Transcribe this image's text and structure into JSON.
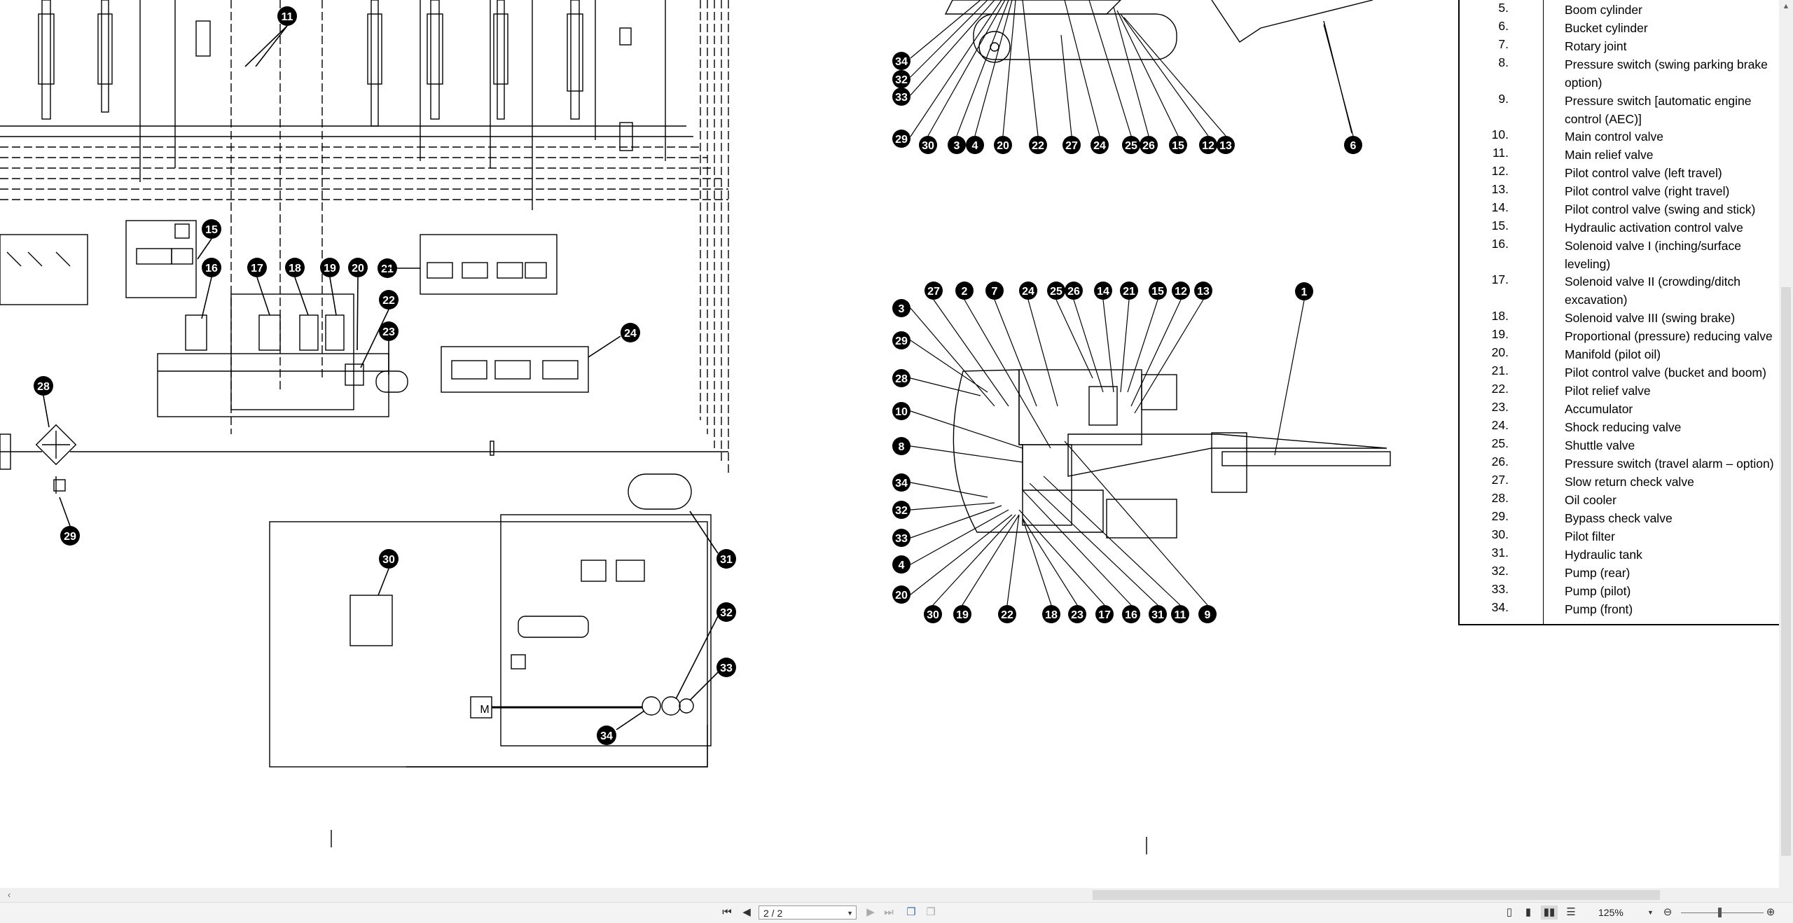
{
  "window": {
    "title": ""
  },
  "document": {
    "legend_items": [
      {
        "num": "5.",
        "text": "Boom cylinder"
      },
      {
        "num": "6.",
        "text": "Bucket cylinder"
      },
      {
        "num": "7.",
        "text": "Rotary joint"
      },
      {
        "num": "8.",
        "text": "Pressure switch (swing parking brake option)"
      },
      {
        "num": "9.",
        "text": "Pressure switch [automatic engine control (AEC)]"
      },
      {
        "num": "10.",
        "text": "Main control valve"
      },
      {
        "num": "11.",
        "text": "Main relief valve"
      },
      {
        "num": "12.",
        "text": "Pilot control valve (left travel)"
      },
      {
        "num": "13.",
        "text": "Pilot control valve (right travel)"
      },
      {
        "num": "14.",
        "text": "Pilot control valve (swing and stick)"
      },
      {
        "num": "15.",
        "text": "Hydraulic activation control valve"
      },
      {
        "num": "16.",
        "text": "Solenoid valve I (inching/surface leveling)"
      },
      {
        "num": "17.",
        "text": "Solenoid valve II (crowding/ditch excavation)"
      },
      {
        "num": "18.",
        "text": "Solenoid valve III (swing brake)"
      },
      {
        "num": "19.",
        "text": "Proportional (pressure) reducing valve"
      },
      {
        "num": "20.",
        "text": "Manifold (pilot oil)"
      },
      {
        "num": "21.",
        "text": "Pilot control valve (bucket and boom)"
      },
      {
        "num": "22.",
        "text": "Pilot relief valve"
      },
      {
        "num": "23.",
        "text": "Accumulator"
      },
      {
        "num": "24.",
        "text": "Shock reducing valve"
      },
      {
        "num": "25.",
        "text": "Shuttle valve"
      },
      {
        "num": "26.",
        "text": "Pressure switch (travel alarm – option)"
      },
      {
        "num": "27.",
        "text": "Slow return check valve"
      },
      {
        "num": "28.",
        "text": "Oil cooler"
      },
      {
        "num": "29.",
        "text": "Bypass check valve"
      },
      {
        "num": "30.",
        "text": "Pilot filter"
      },
      {
        "num": "31.",
        "text": "Hydraulic tank"
      },
      {
        "num": "32.",
        "text": "Pump (rear)"
      },
      {
        "num": "33.",
        "text": "Pump (pilot)"
      },
      {
        "num": "34.",
        "text": "Pump (front)"
      }
    ],
    "schematic_callouts": [
      "11",
      "15",
      "16",
      "17",
      "18",
      "19",
      "20",
      "21",
      "22",
      "23",
      "24",
      "28",
      "29",
      "30",
      "31",
      "32",
      "33",
      "34"
    ],
    "motor_label": "M",
    "side_view_callouts": [
      "34",
      "32",
      "33",
      "29",
      "30",
      "3",
      "4",
      "20",
      "22",
      "27",
      "24",
      "25",
      "26",
      "15",
      "12",
      "13",
      "6"
    ],
    "top_view_callouts": [
      "27",
      "2",
      "7",
      "24",
      "25",
      "26",
      "14",
      "21",
      "15",
      "12",
      "13",
      "1",
      "3",
      "29",
      "28",
      "10",
      "8",
      "34",
      "32",
      "33",
      "4",
      "20",
      "30",
      "19",
      "22",
      "18",
      "23",
      "17",
      "16",
      "31",
      "11",
      "9"
    ]
  },
  "statusbar": {
    "first_page_icon": "first-page-icon",
    "prev_page_icon": "prev-page-icon",
    "page_indicator": "2 / 2",
    "next_page_icon": "next-page-icon",
    "last_page_icon": "last-page-icon",
    "zoom": "125%",
    "zoom_out_icon": "zoom-out-icon",
    "zoom_in_icon": "zoom-in-icon"
  },
  "colors": {
    "ink": "#000000",
    "paper": "#ffffff",
    "chrome": "#f3f3f3"
  }
}
